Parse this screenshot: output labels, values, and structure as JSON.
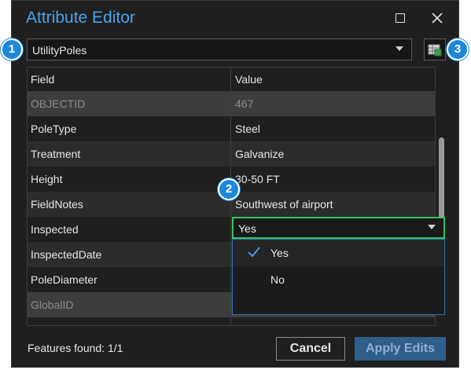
{
  "dialog": {
    "title": "Attribute Editor",
    "layer_select": "UtilityPoles",
    "grid": {
      "headers": [
        "Field",
        "Value"
      ],
      "rows": [
        {
          "field": "OBJECTID",
          "value": "467"
        },
        {
          "field": "PoleType",
          "value": "Steel"
        },
        {
          "field": "Treatment",
          "value": "Galvanize"
        },
        {
          "field": "Height",
          "value": "30-50 FT"
        },
        {
          "field": "FieldNotes",
          "value": "Southwest of airport"
        },
        {
          "field": "Inspected",
          "value": ""
        },
        {
          "field": "InspectedDate",
          "value": ""
        },
        {
          "field": "PoleDiameter",
          "value": ""
        },
        {
          "field": "GlobalID",
          "value": ""
        }
      ]
    },
    "dropdown": {
      "selected": "Yes",
      "options": [
        "Yes",
        "No"
      ]
    },
    "footer": {
      "features_found": "Features found: 1/1",
      "cancel_label": "Cancel",
      "apply_label": "Apply Edits"
    }
  },
  "callouts": [
    "1",
    "2",
    "3"
  ],
  "colors": {
    "accent": "#4aa3ee",
    "focus_border": "#36c15a",
    "callout": "#1e88d8",
    "apply_button": "#2f5e8a"
  },
  "icons": [
    "maximize-icon",
    "close-icon",
    "chevron-down-icon",
    "layer-table-icon",
    "checkmark-icon"
  ]
}
